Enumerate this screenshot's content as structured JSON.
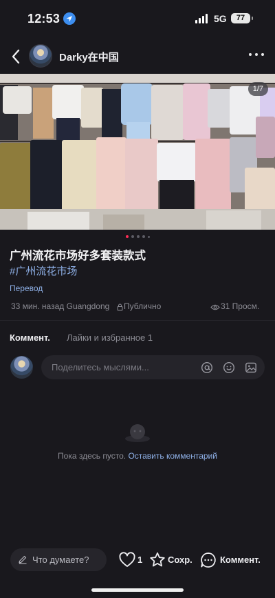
{
  "status_bar": {
    "time": "12:53",
    "network": "5G",
    "battery": "77"
  },
  "header": {
    "author": "Darky在中国"
  },
  "post": {
    "image_counter": "1/7",
    "title": "广州流花市场好多套装款式",
    "hashtag": "#广州流花市场",
    "translate": "Перевод",
    "time_location": "33 мин. назад Guangdong",
    "privacy": "Публично",
    "views": "31 Просм."
  },
  "tabs": {
    "comments": "Коммент.",
    "likes": "Лайки и избранное 1"
  },
  "comment_box": {
    "placeholder": "Поделитесь мыслями..."
  },
  "empty": {
    "text": "Пока здесь пусто.",
    "link": "Оставить комментарий"
  },
  "bottom_bar": {
    "input_placeholder": "Что думаете?",
    "likes_count": "1",
    "save_label": "Сохр.",
    "comment_label": "Коммент."
  },
  "colors": {
    "background": "#19181d",
    "accent_link": "#8fb1e8",
    "active_dot": "#ff2d55"
  }
}
